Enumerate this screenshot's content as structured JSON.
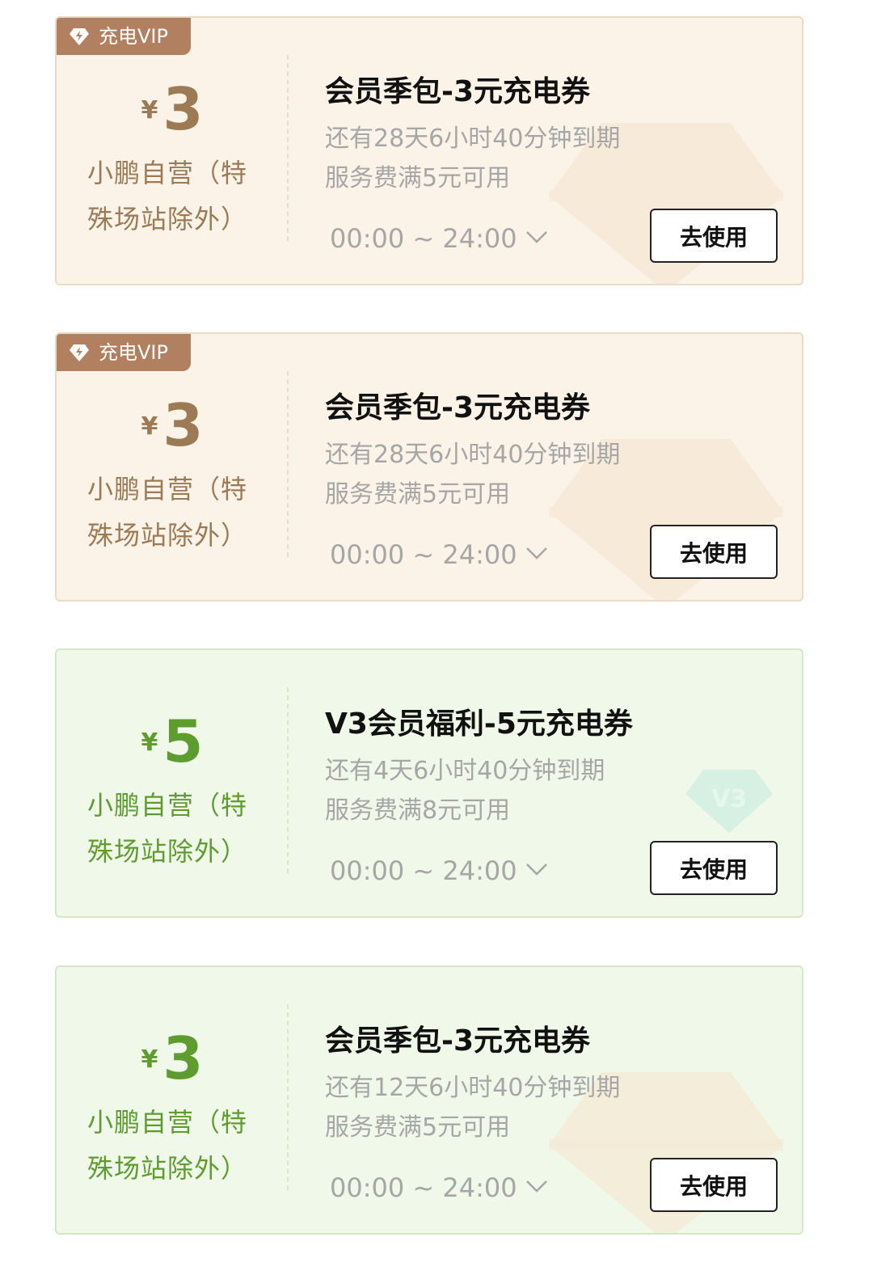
{
  "colors": {
    "gold": "#9b7a55",
    "green": "#5e9c30",
    "vip_tag": "#b18060",
    "muted_text": "#a6a6a6"
  },
  "coupons": [
    {
      "theme": "gold",
      "tag": "充电VIP",
      "currency": "¥",
      "amount": "3",
      "scope": "小鹏自营（特殊场站除外）",
      "title": "会员季包-3元充电券",
      "expiry": "还有28天6小时40分钟到期",
      "condition": "服务费满5元可用",
      "time_range": "00:00 ~ 24:00",
      "button": "去使用"
    },
    {
      "theme": "gold",
      "tag": "充电VIP",
      "currency": "¥",
      "amount": "3",
      "scope": "小鹏自营（特殊场站除外）",
      "title": "会员季包-3元充电券",
      "expiry": "还有28天6小时40分钟到期",
      "condition": "服务费满5元可用",
      "time_range": "00:00 ~ 24:00",
      "button": "去使用"
    },
    {
      "theme": "green",
      "currency": "¥",
      "amount": "5",
      "scope": "小鹏自营（特殊场站除外）",
      "title": "V3会员福利-5元充电券",
      "expiry": "还有4天6小时40分钟到期",
      "condition": "服务费满8元可用",
      "time_range": "00:00 ~ 24:00",
      "button": "去使用",
      "badge": "V3"
    },
    {
      "theme": "green",
      "currency": "¥",
      "amount": "3",
      "scope": "小鹏自营（特殊场站除外）",
      "title": "会员季包-3元充电券",
      "expiry": "还有12天6小时40分钟到期",
      "condition": "服务费满5元可用",
      "time_range": "00:00 ~ 24:00",
      "button": "去使用"
    }
  ]
}
